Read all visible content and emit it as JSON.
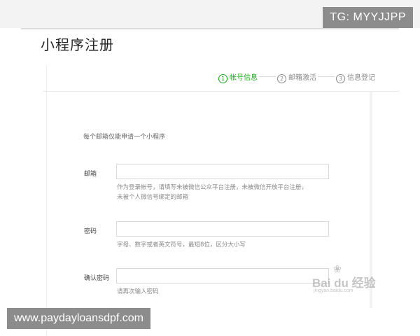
{
  "watermarks": {
    "top_right": "TG: MYYJJPP",
    "bottom_left": "www.paydayloansdpf.com",
    "baidu_text": "Bai du 经验",
    "baidu_sub": "jingyan.baidu.com"
  },
  "page_title": "小程序注册",
  "steps": [
    {
      "num": "1",
      "label": "帐号信息",
      "active": true
    },
    {
      "num": "2",
      "label": "邮箱激活",
      "active": false
    },
    {
      "num": "3",
      "label": "信息登记",
      "active": false
    }
  ],
  "notice": "每个邮箱仅能申请一个小程序",
  "form": {
    "email": {
      "label": "邮箱",
      "value": "",
      "hint_line1": "作为登录帐号，请填写未被微信公众平台注册，未被微信开放平台注册，",
      "hint_line2": "未被个人微信号绑定的邮箱"
    },
    "password": {
      "label": "密码",
      "value": "",
      "hint": "字母、数字或者英文符号，最短8位，区分大小写"
    },
    "confirm_password": {
      "label": "确认密码",
      "value": "",
      "hint": "请再次输入密码"
    }
  },
  "colors": {
    "active_step": "#1aad19",
    "watermark_bg": "#8c8c8c"
  }
}
